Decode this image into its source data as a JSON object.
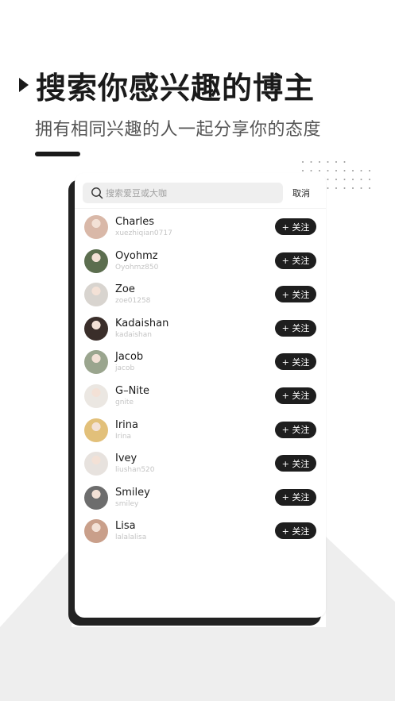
{
  "promo": {
    "title": "搜索你感兴趣的博主",
    "subtitle": "拥有相同兴趣的人一起分享你的态度"
  },
  "search": {
    "placeholder": "搜索爱豆或大咖",
    "cancel_label": "取消"
  },
  "follow_label": "+ 关注",
  "users": [
    {
      "name": "Charles",
      "handle": "xuezhiqian0717",
      "avatar_color": "#d9b8a8"
    },
    {
      "name": "Oyohmz",
      "handle": "Oyohmz850",
      "avatar_color": "#5c6e4f"
    },
    {
      "name": "Zoe",
      "handle": "zoe01258",
      "avatar_color": "#d8d4cf"
    },
    {
      "name": "Kadaishan",
      "handle": "kadaishan",
      "avatar_color": "#3a2e2a"
    },
    {
      "name": "Jacob",
      "handle": "jacob",
      "avatar_color": "#9aa58e"
    },
    {
      "name": "G–Nite",
      "handle": "gnite",
      "avatar_color": "#ebe7e2"
    },
    {
      "name": "Irina",
      "handle": "Irina",
      "avatar_color": "#e2c07a"
    },
    {
      "name": "Ivey",
      "handle": "liushan520",
      "avatar_color": "#e7e2de"
    },
    {
      "name": "Smiley",
      "handle": "smiley",
      "avatar_color": "#6d6d6d"
    },
    {
      "name": "Lisa",
      "handle": "lalalalisa",
      "avatar_color": "#c99f8a"
    }
  ]
}
